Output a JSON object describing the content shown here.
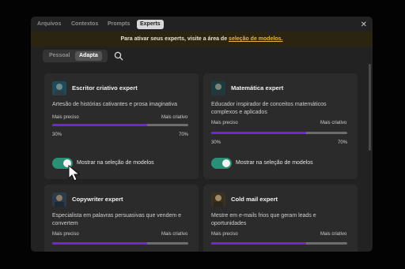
{
  "tabs": [
    {
      "label": "Arquivos",
      "active": false
    },
    {
      "label": "Contextos",
      "active": false
    },
    {
      "label": "Prompts",
      "active": false
    },
    {
      "label": "Experts",
      "active": true
    }
  ],
  "banner": {
    "text": "Para ativar seus experts, visite a área de ",
    "link": "seleção de modelos."
  },
  "segments": [
    {
      "label": "Pessoal",
      "active": false
    },
    {
      "label": "Adapta",
      "active": true
    }
  ],
  "icons": {
    "search": "search-icon",
    "close": "close-icon"
  },
  "colors": {
    "accent_fill": "#6a2bd6",
    "toggle_on": "#2a8f74",
    "link": "#e7b544"
  },
  "cards": [
    {
      "title": "Escritor criativo expert",
      "description": "Artesão de histórias cativantes e prosa imaginativa",
      "left_label": "Mais preciso",
      "right_label": "Mais criativo",
      "precision_pct": "30%",
      "creativity_pct": "70%",
      "creativity_level": 0.7,
      "toggle_label": "Mostrar na seleção de modelos",
      "toggle_on": true
    },
    {
      "title": "Matemática expert",
      "description": "Educador inspirador de conceitos matemáticos complexos e aplicados",
      "left_label": "Mais preciso",
      "right_label": "Mais criativo",
      "precision_pct": "30%",
      "creativity_pct": "70%",
      "creativity_level": 0.7,
      "toggle_label": "Mostrar na seleção de modelos",
      "toggle_on": true
    },
    {
      "title": "Copywriter expert",
      "description": "Especialista em palavras persuasivas que vendem e convertem",
      "left_label": "Mais preciso",
      "right_label": "Mais criativo",
      "creativity_level": 0.7
    },
    {
      "title": "Cold mail expert",
      "description": "Mestre em e-mails frios que geram leads e oportunidades",
      "left_label": "Mais preciso",
      "right_label": "Mais criativo",
      "creativity_level": 0.7
    }
  ]
}
